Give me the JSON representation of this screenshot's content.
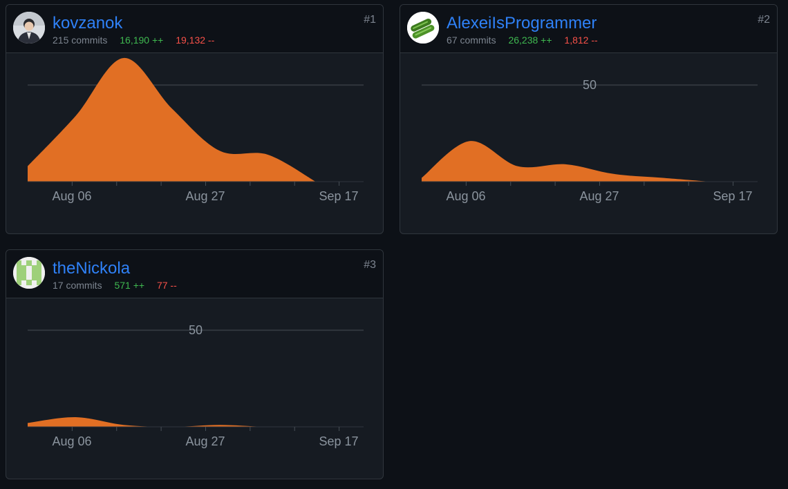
{
  "contributors": [
    {
      "username": "kovzanok",
      "commits": "215 commits",
      "additions": "16,190 ++",
      "deletions": "19,132 --",
      "rank": "#1",
      "avatar_icon": "person-photo-icon"
    },
    {
      "username": "AlexeiIsProgrammer",
      "commits": "67 commits",
      "additions": "26,238 ++",
      "deletions": "1,812 --",
      "rank": "#2",
      "avatar_icon": "cucumber-photo-icon"
    },
    {
      "username": "theNickola",
      "commits": "17 commits",
      "additions": "571 ++",
      "deletions": "77 --",
      "rank": "#3",
      "avatar_icon": "identicon-icon"
    }
  ],
  "colors": {
    "area_fill": "#e16f24",
    "username": "#2f81f7",
    "additions": "#3fb950",
    "deletions": "#f85149"
  },
  "chart_data": [
    {
      "type": "area",
      "title": "",
      "x_tick_labels": [
        "Aug 06",
        "Aug 27",
        "Sep 17"
      ],
      "y_tick_labels": [],
      "ylim": [
        0,
        60
      ],
      "gridline_values": [
        50
      ],
      "x": [
        0,
        1,
        2,
        3,
        4,
        5,
        6,
        7
      ],
      "values": [
        8,
        34,
        64,
        38,
        16,
        14,
        0,
        0
      ]
    },
    {
      "type": "area",
      "title": "",
      "x_tick_labels": [
        "Aug 06",
        "Aug 27",
        "Sep 17"
      ],
      "y_tick_labels": [
        "50"
      ],
      "ylim": [
        0,
        60
      ],
      "gridline_values": [
        50
      ],
      "x": [
        0,
        1,
        2,
        3,
        4,
        5,
        6,
        7
      ],
      "values": [
        2,
        21,
        8,
        9,
        4,
        2,
        0,
        0
      ]
    },
    {
      "type": "area",
      "title": "",
      "x_tick_labels": [
        "Aug 06",
        "Aug 27",
        "Sep 17"
      ],
      "y_tick_labels": [
        "50"
      ],
      "ylim": [
        0,
        60
      ],
      "gridline_values": [
        50
      ],
      "x": [
        0,
        1,
        2,
        3,
        4,
        5,
        6,
        7
      ],
      "values": [
        2,
        5,
        1,
        0,
        1,
        0,
        0,
        0
      ]
    }
  ]
}
